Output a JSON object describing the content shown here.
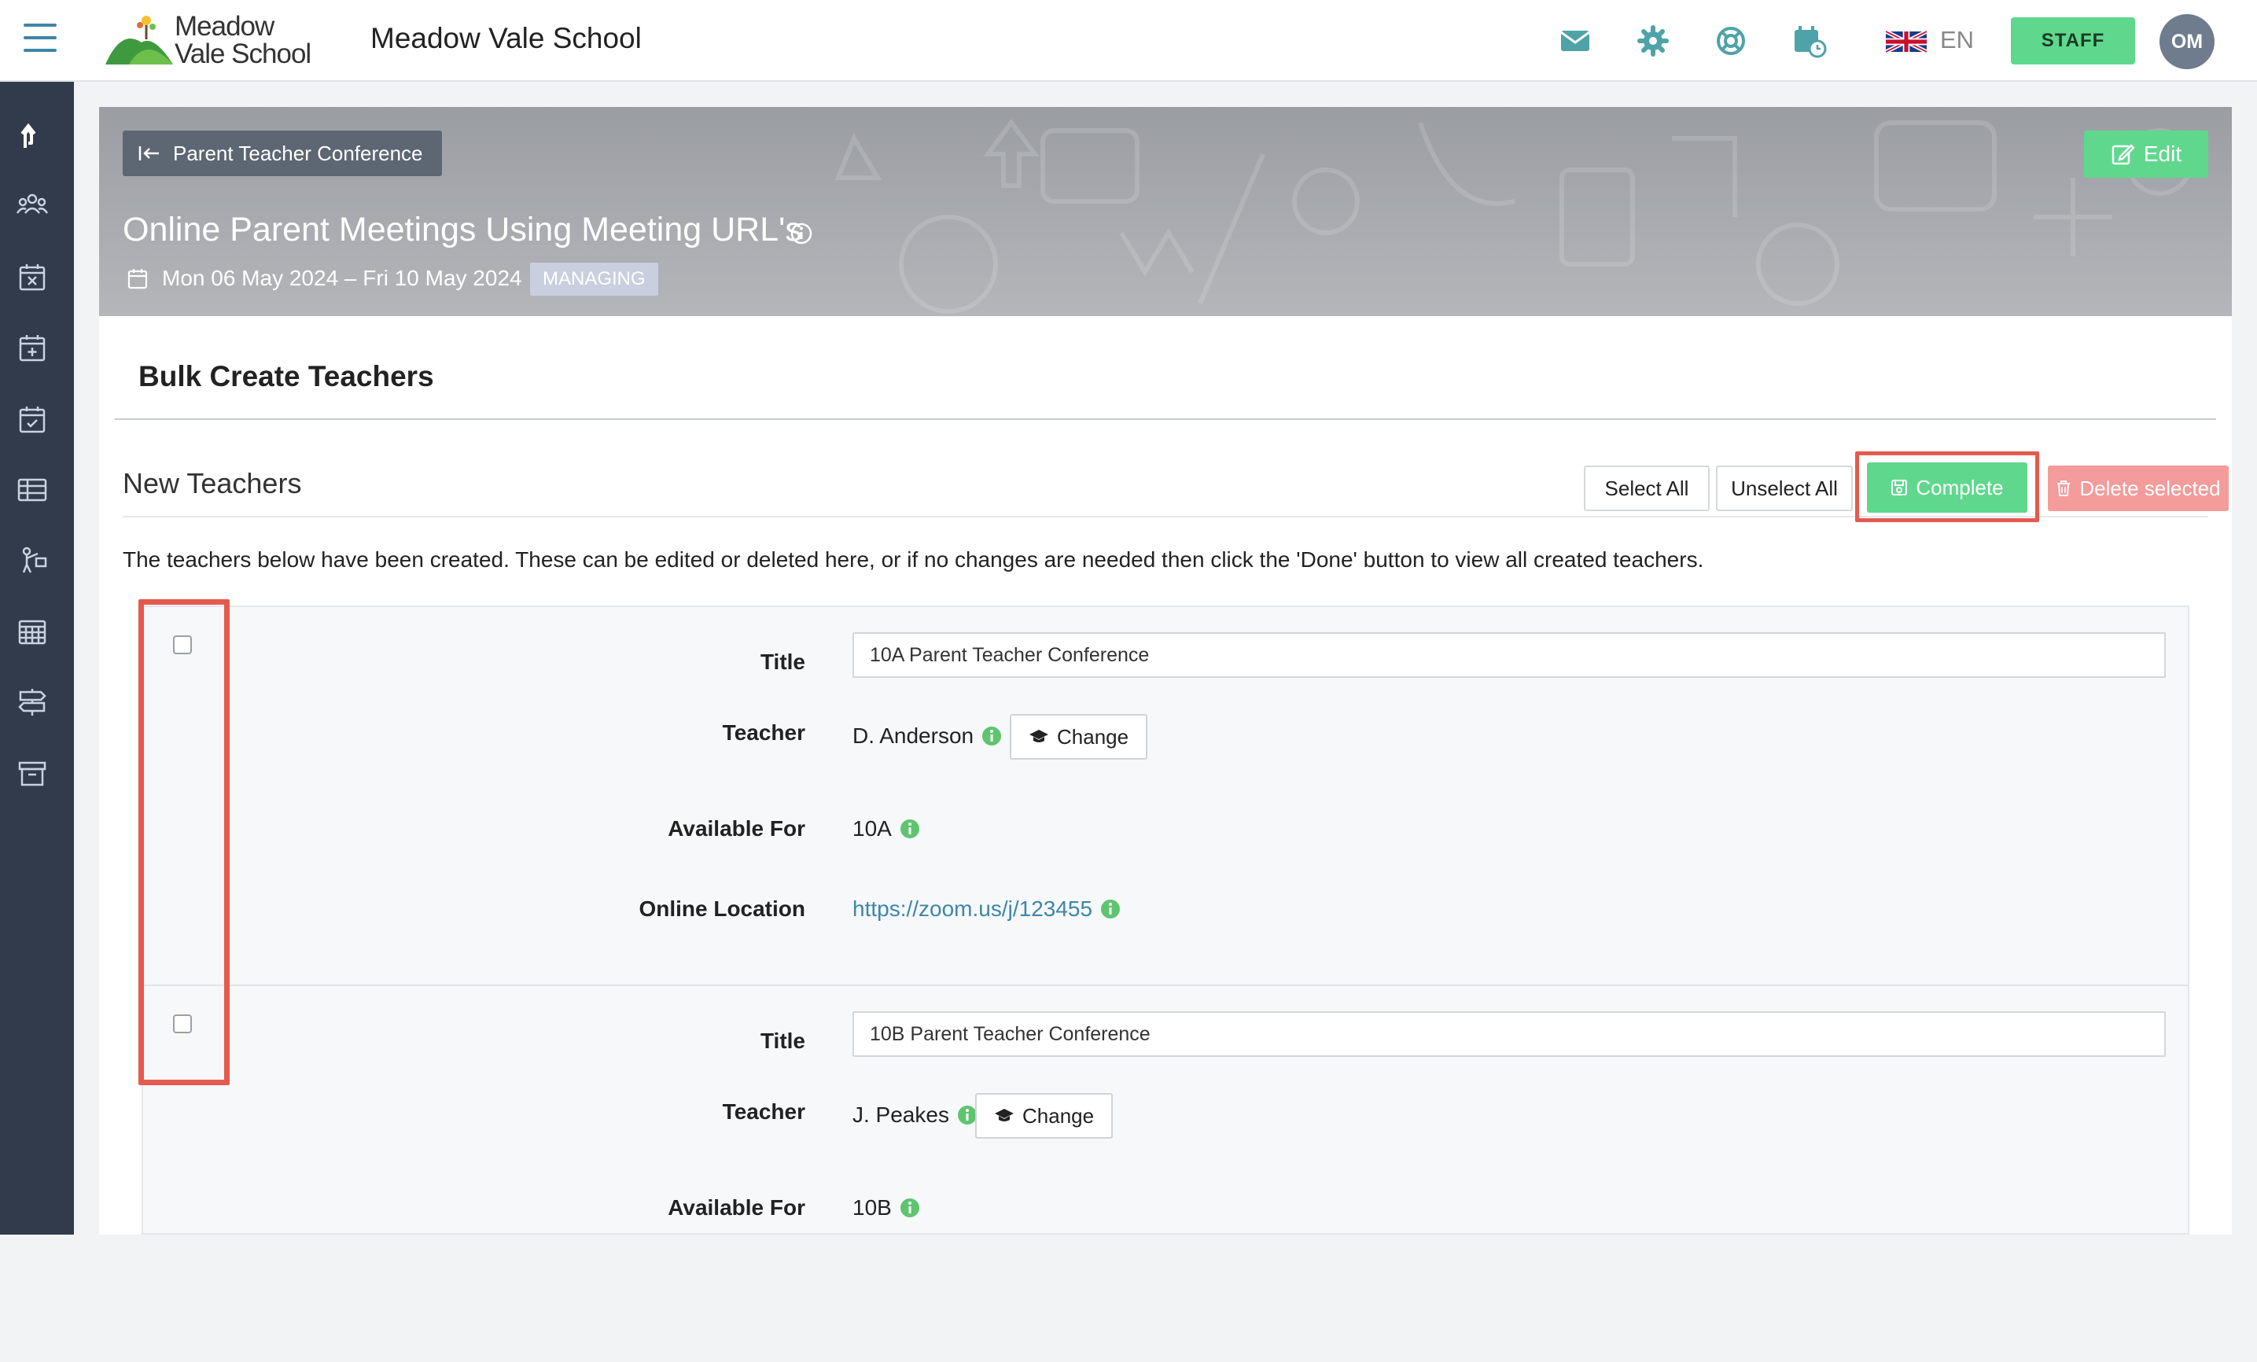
{
  "header": {
    "logo_text": "Meadow\nVale School",
    "school_name": "Meadow Vale School",
    "icons": [
      "mail-icon",
      "gear-icon",
      "lifebuoy-icon",
      "calendar-clock-icon"
    ],
    "language": "EN",
    "role_button": "STAFF",
    "avatar_initials": "OM"
  },
  "sidebar": {
    "icons": [
      "return-arrow-icon",
      "people-group-icon",
      "calendar-x-icon",
      "calendar-plus-icon",
      "calendar-check-icon",
      "table-icon",
      "person-pointing-icon",
      "calendar-grid-icon",
      "signpost-icon",
      "archive-icon"
    ]
  },
  "event": {
    "back_label": "Parent Teacher Conference",
    "edit_label": "Edit",
    "title": "Online Parent Meetings Using Meeting URL's",
    "date_range": "Mon 06 May 2024 – Fri 10 May 2024",
    "status_badge": "MANAGING"
  },
  "panel": {
    "title": "Bulk Create Teachers",
    "section_title": "New Teachers",
    "buttons": {
      "select_all": "Select All",
      "unselect_all": "Unselect All",
      "complete": "Complete",
      "delete_selected": "Delete selected"
    },
    "description": "The teachers below have been created. These can be edited or deleted here, or if no changes are needed then click the 'Done' button to view all created teachers."
  },
  "labels": {
    "title": "Title",
    "teacher": "Teacher",
    "available_for": "Available For",
    "online_location": "Online Location",
    "change": "Change"
  },
  "teachers": [
    {
      "title_value": "10A Parent Teacher Conference",
      "teacher": "D. Anderson",
      "available_for": "10A",
      "online_location": "https://zoom.us/j/123455"
    },
    {
      "title_value": "10B Parent Teacher Conference",
      "teacher": "J. Peakes",
      "available_for": "10B"
    }
  ],
  "colors": {
    "accent_green": "#5fd88d",
    "sidebar": "#313b4b",
    "link": "#3e86a8",
    "highlight": "#e55a4e",
    "danger_light": "#f49b9b"
  }
}
